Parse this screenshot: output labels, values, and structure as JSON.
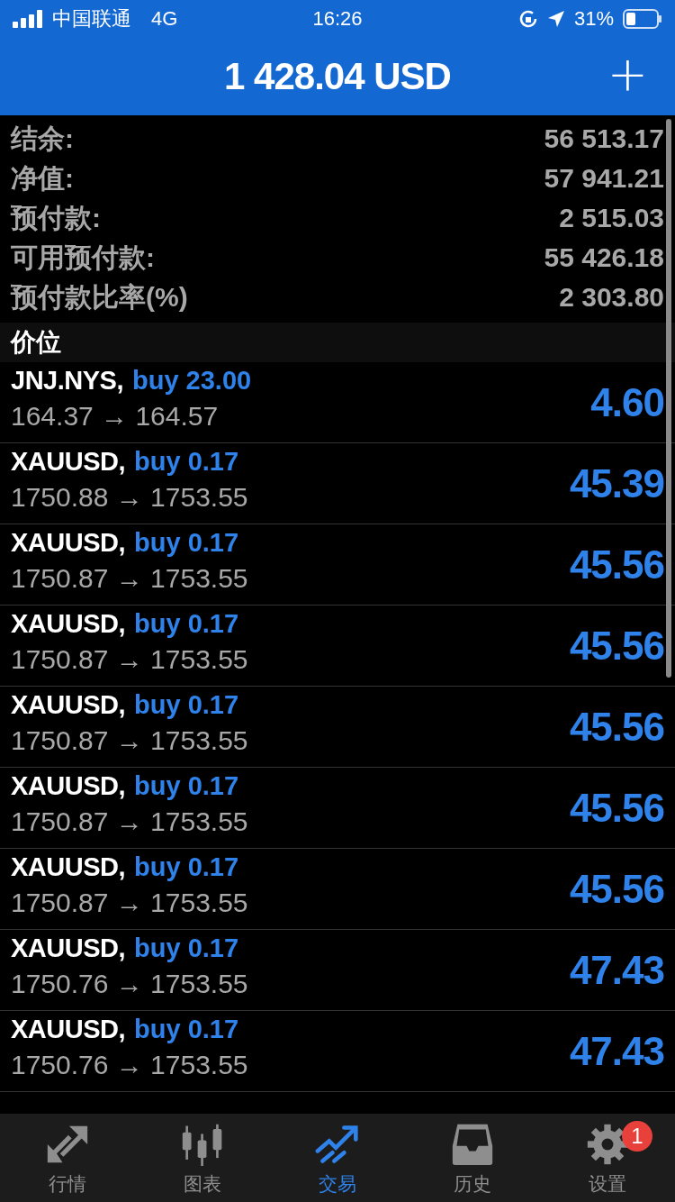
{
  "status_bar": {
    "carrier": "中国联通",
    "network": "4G",
    "time": "16:26",
    "battery": "31%"
  },
  "header": {
    "title": "1 428.04 USD",
    "add": "+"
  },
  "summary": [
    {
      "label": "结余:",
      "value": "56 513.17"
    },
    {
      "label": "净值:",
      "value": "57 941.21"
    },
    {
      "label": "预付款:",
      "value": "2 515.03"
    },
    {
      "label": "可用预付款:",
      "value": "55 426.18"
    },
    {
      "label": "预付款比率(%)",
      "value": "2 303.80"
    }
  ],
  "section": "价位",
  "positions": [
    {
      "symbol": "JNJ.NYS,",
      "order": "buy 23.00",
      "prices": "164.37 → 164.57",
      "profit": "4.60"
    },
    {
      "symbol": "XAUUSD,",
      "order": "buy 0.17",
      "prices": "1750.88 → 1753.55",
      "profit": "45.39"
    },
    {
      "symbol": "XAUUSD,",
      "order": "buy 0.17",
      "prices": "1750.87 → 1753.55",
      "profit": "45.56"
    },
    {
      "symbol": "XAUUSD,",
      "order": "buy 0.17",
      "prices": "1750.87 → 1753.55",
      "profit": "45.56"
    },
    {
      "symbol": "XAUUSD,",
      "order": "buy 0.17",
      "prices": "1750.87 → 1753.55",
      "profit": "45.56"
    },
    {
      "symbol": "XAUUSD,",
      "order": "buy 0.17",
      "prices": "1750.87 → 1753.55",
      "profit": "45.56"
    },
    {
      "symbol": "XAUUSD,",
      "order": "buy 0.17",
      "prices": "1750.87 → 1753.55",
      "profit": "45.56"
    },
    {
      "symbol": "XAUUSD,",
      "order": "buy 0.17",
      "prices": "1750.76 → 1753.55",
      "profit": "47.43"
    },
    {
      "symbol": "XAUUSD,",
      "order": "buy 0.17",
      "prices": "1750.76 → 1753.55",
      "profit": "47.43"
    }
  ],
  "tabs": [
    {
      "kind": "quotes",
      "label": "行情",
      "selected": false
    },
    {
      "kind": "chart",
      "label": "图表",
      "selected": false
    },
    {
      "kind": "trade",
      "label": "交易",
      "selected": true
    },
    {
      "kind": "history",
      "label": "历史",
      "selected": false
    },
    {
      "kind": "settings",
      "label": "设置",
      "selected": false,
      "badge": "1"
    }
  ]
}
